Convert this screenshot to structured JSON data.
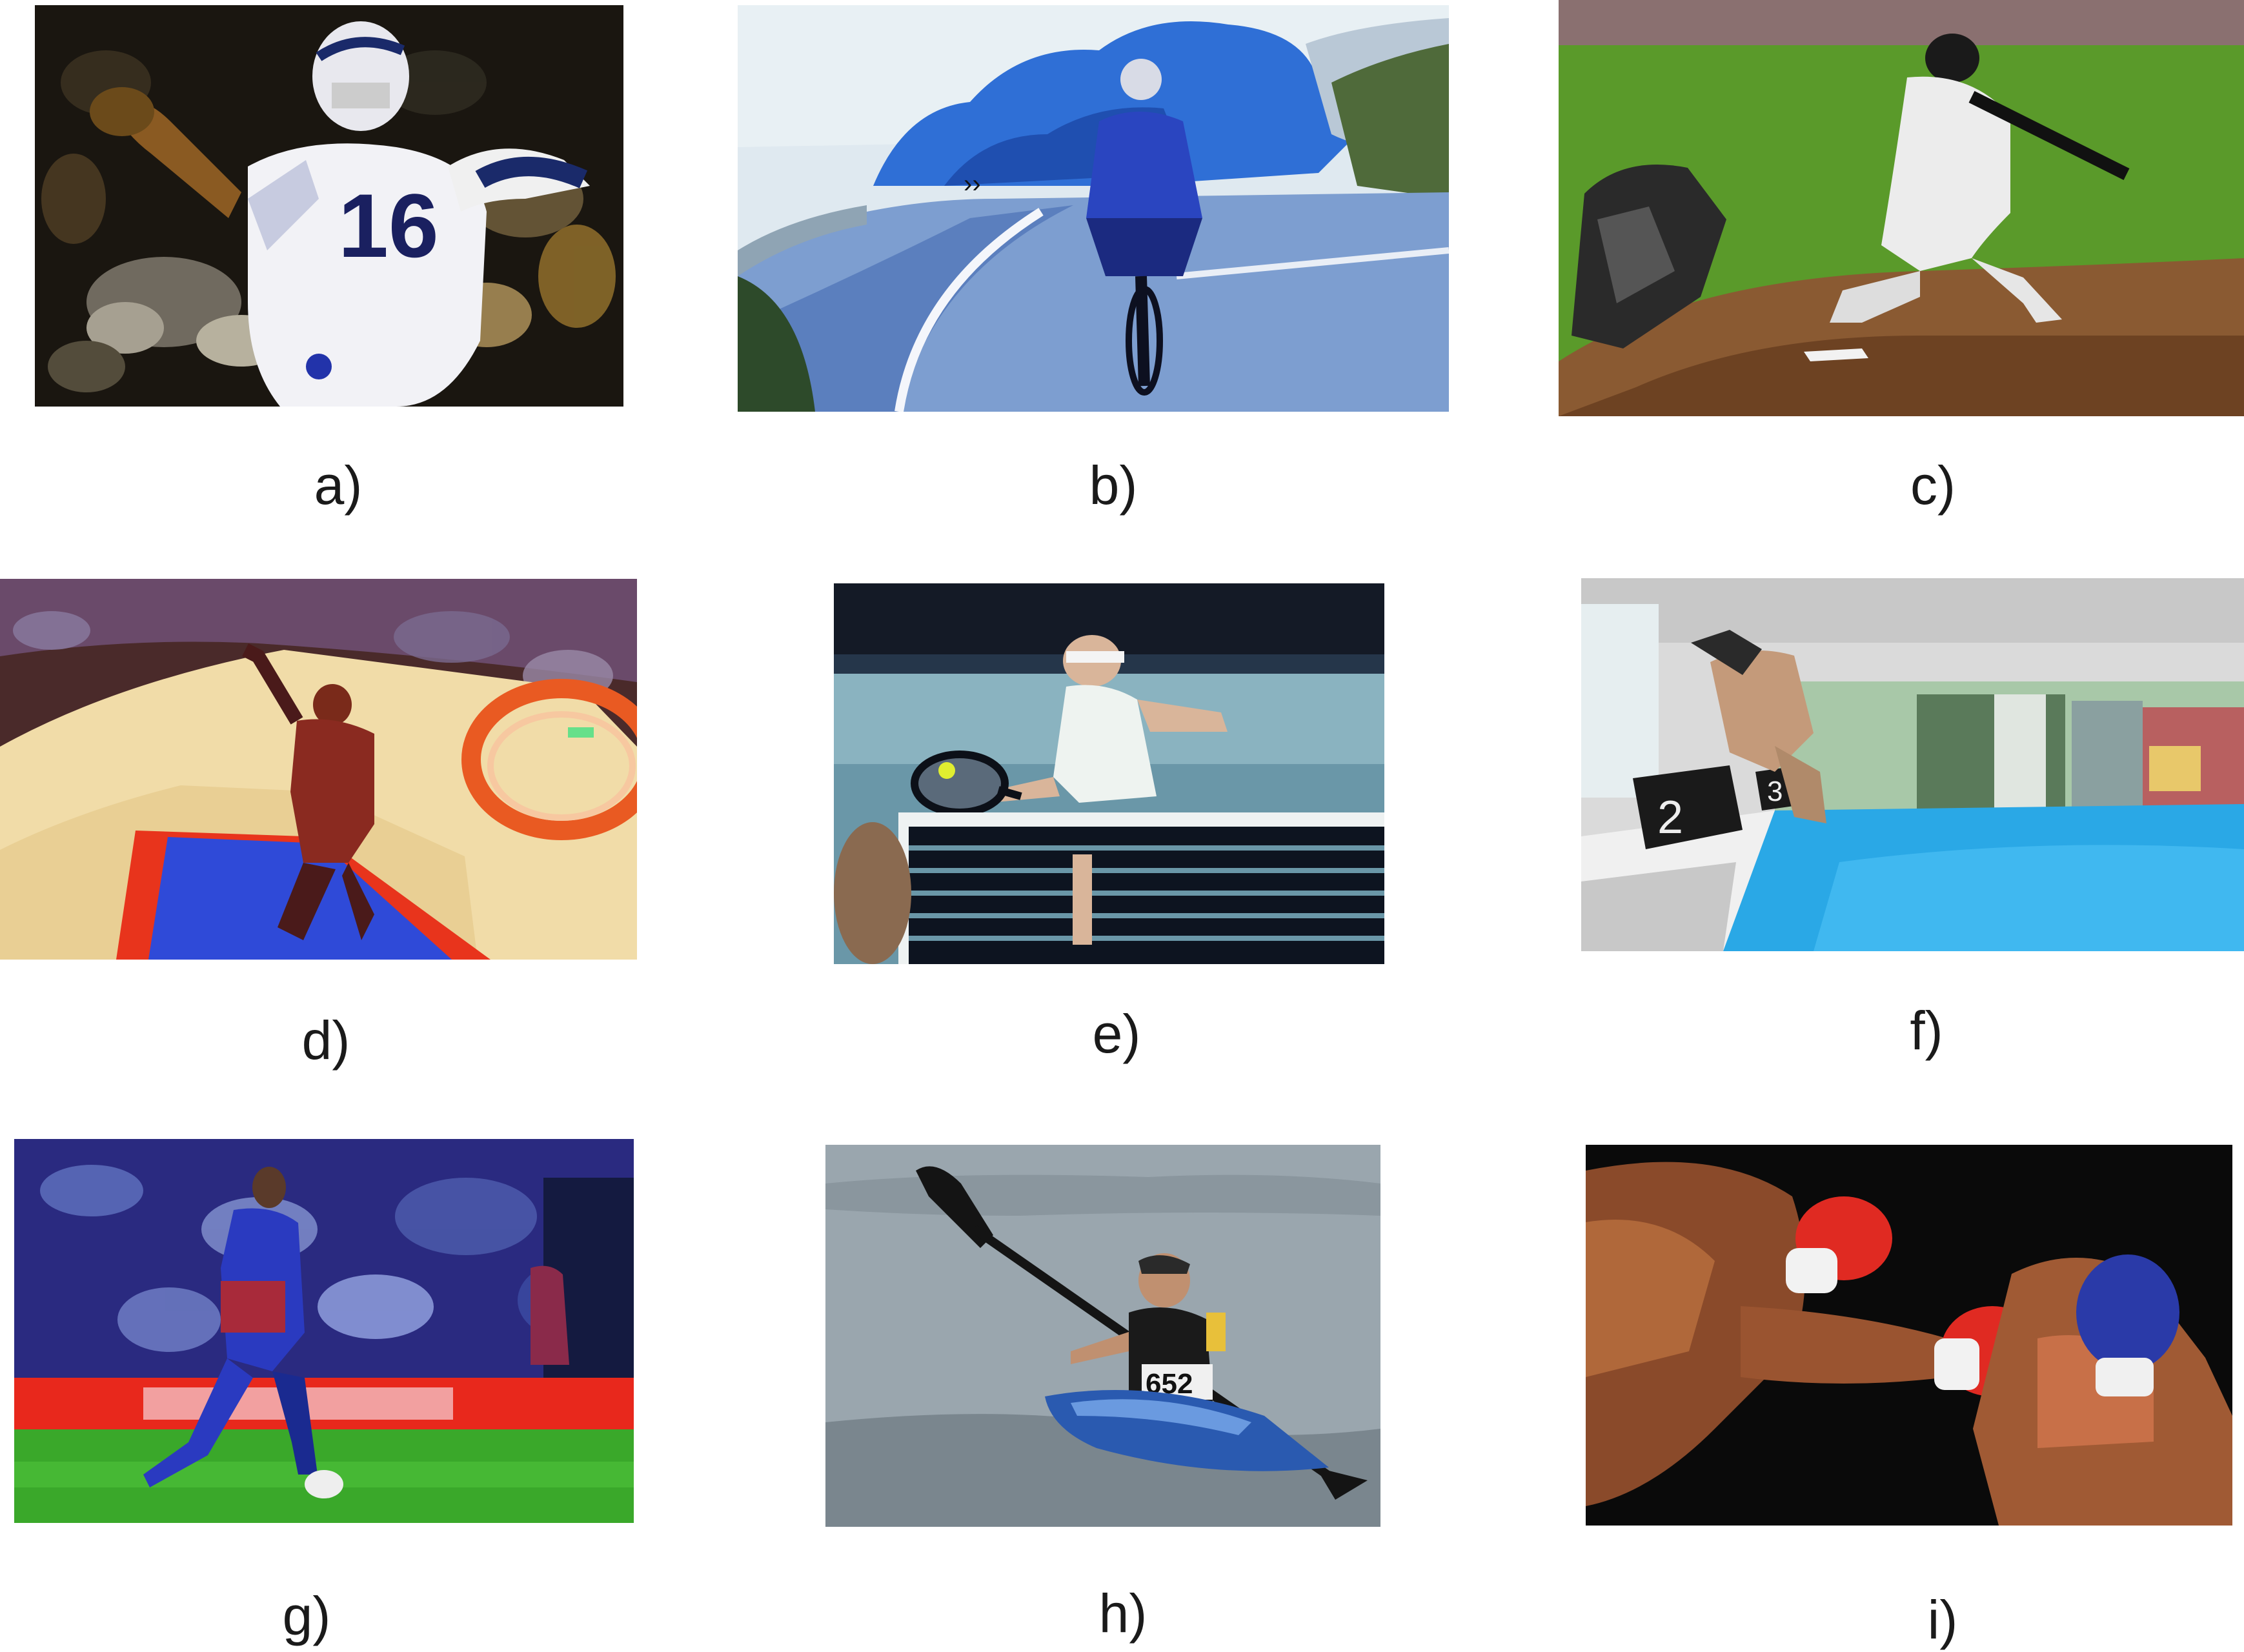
{
  "figure": {
    "panels": [
      {
        "id": "a",
        "caption": "a)",
        "jersey_number": "16",
        "subject": "american-football-quarterback"
      },
      {
        "id": "b",
        "caption": "b)",
        "subject": "road-cyclist"
      },
      {
        "id": "c",
        "caption": "c)",
        "subject": "baseball-batter"
      },
      {
        "id": "d",
        "caption": "d)",
        "subject": "basketball-dunk"
      },
      {
        "id": "e",
        "caption": "e)",
        "subject": "tennis-player-at-net"
      },
      {
        "id": "f",
        "caption": "f)",
        "lane_labels": [
          "2",
          "3"
        ],
        "subject": "swimmer-diving"
      },
      {
        "id": "g",
        "caption": "g)",
        "subject": "soccer-player"
      },
      {
        "id": "h",
        "caption": "h)",
        "bib_number": "652",
        "subject": "kayaker"
      },
      {
        "id": "i",
        "caption": "i)",
        "subject": "boxers"
      }
    ],
    "colors": {
      "caption_text": "#1a1a1a",
      "background": "#ffffff"
    }
  }
}
